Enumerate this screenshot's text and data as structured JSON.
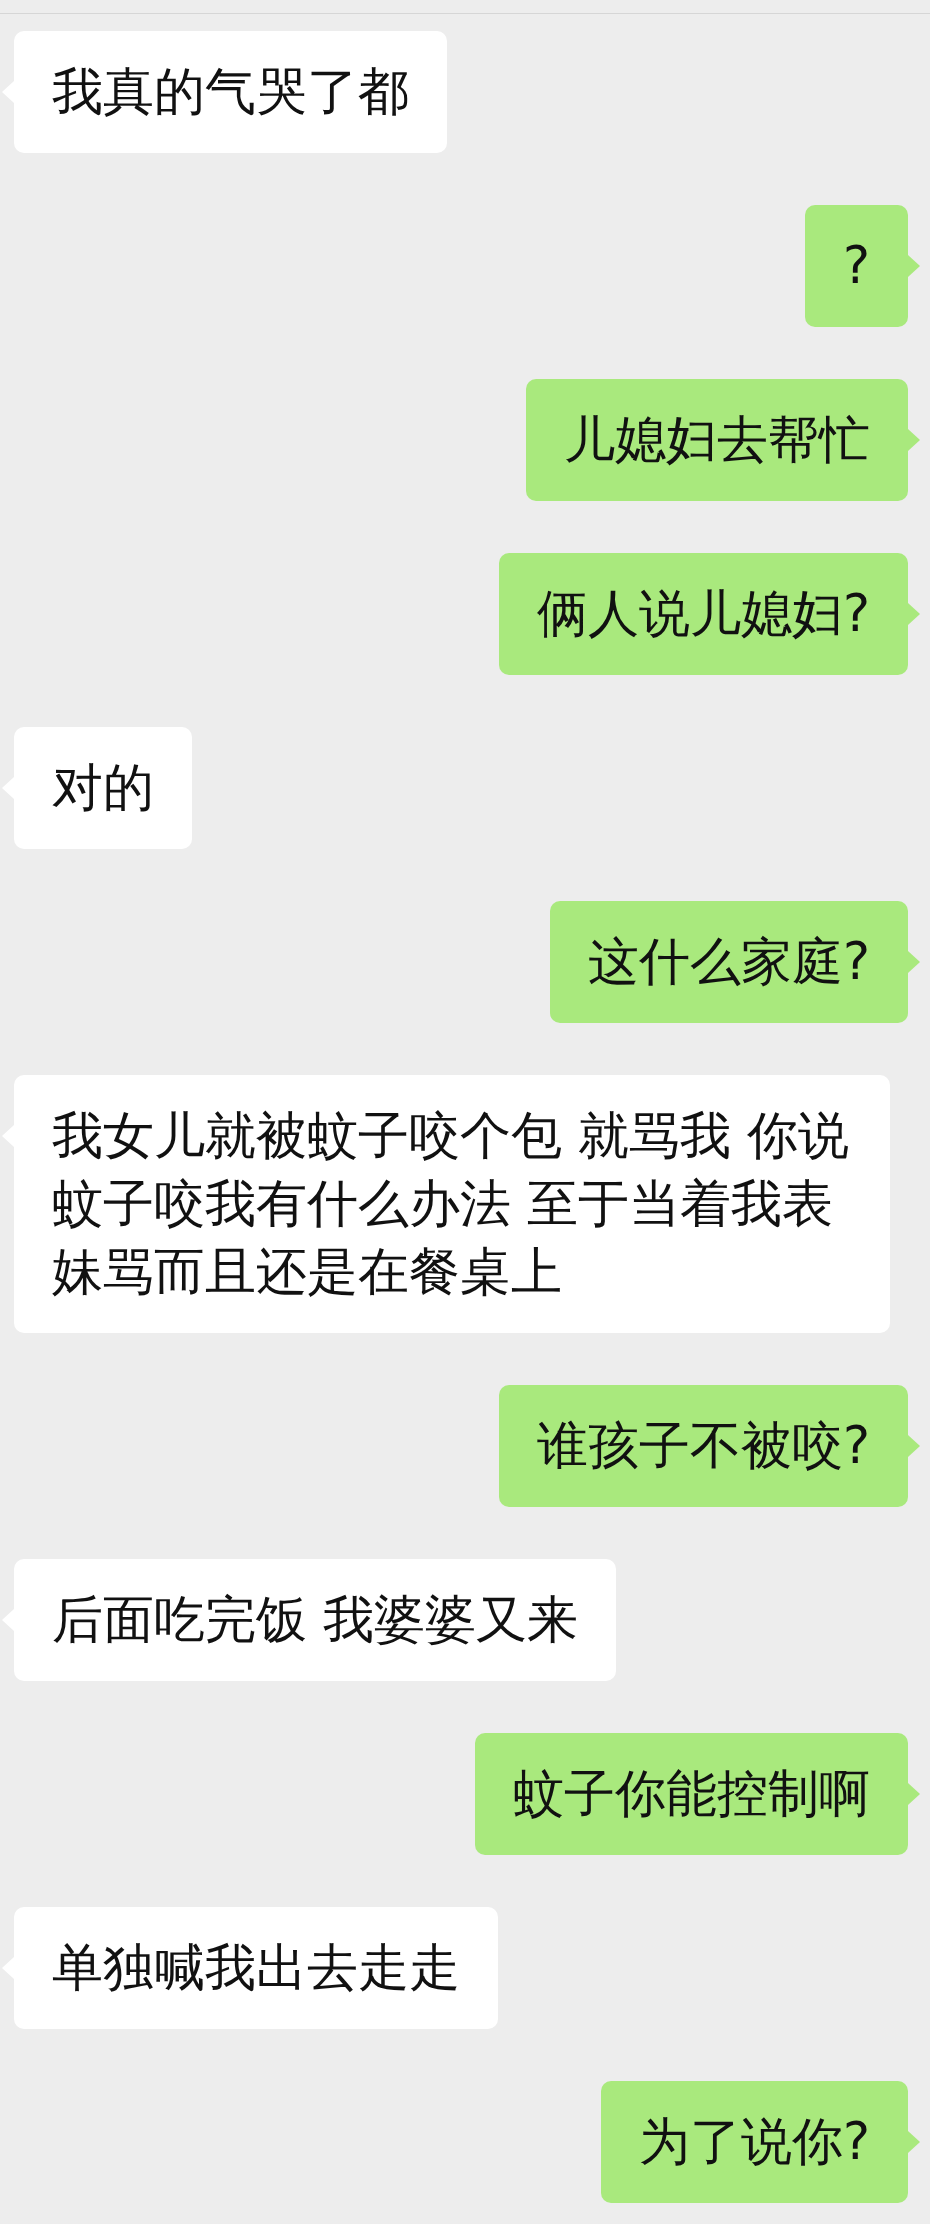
{
  "messages": [
    {
      "kind": "received",
      "text": "我真的气哭了都"
    },
    {
      "kind": "sent",
      "text": "?"
    },
    {
      "kind": "sent",
      "text": "儿媳妇去帮忙"
    },
    {
      "kind": "sent",
      "text": "俩人说儿媳妇?"
    },
    {
      "kind": "received",
      "text": "对的"
    },
    {
      "kind": "sent",
      "text": "这什么家庭?"
    },
    {
      "kind": "received",
      "text": "我女儿就被蚊子咬个包 就骂我 你说蚊子咬我有什么办法 至于当着我表妹骂而且还是在餐桌上"
    },
    {
      "kind": "sent",
      "text": "谁孩子不被咬?"
    },
    {
      "kind": "received",
      "text": "后面吃完饭 我婆婆又来"
    },
    {
      "kind": "sent",
      "text": "蚊子你能控制啊"
    },
    {
      "kind": "received",
      "text": "单独喊我出去走走"
    },
    {
      "kind": "sent",
      "text": "为了说你?"
    }
  ]
}
